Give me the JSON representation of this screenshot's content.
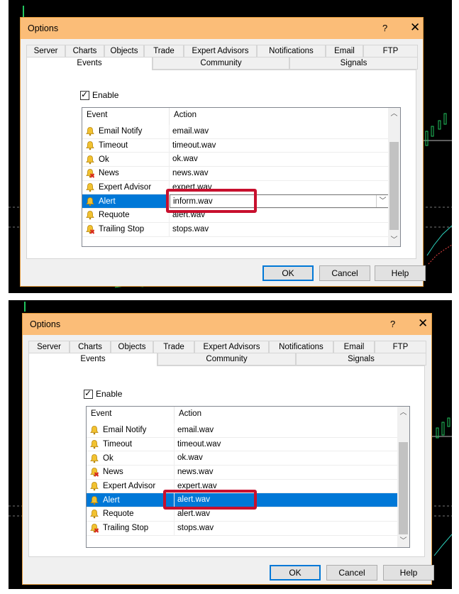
{
  "dialog": {
    "title": "Options",
    "help_glyph": "?",
    "close_glyph": "✕",
    "tabs_row1": [
      "Server",
      "Charts",
      "Objects",
      "Trade",
      "Expert Advisors",
      "Notifications",
      "Email",
      "FTP"
    ],
    "tabs_row2": [
      "Events",
      "Community",
      "Signals"
    ],
    "active_tab": "Events",
    "enable_label": "Enable",
    "enable_checked": true,
    "columns": {
      "event": "Event",
      "action": "Action"
    },
    "buttons": {
      "ok": "OK",
      "cancel": "Cancel",
      "help": "Help"
    }
  },
  "screenshot_top": {
    "rows": [
      {
        "event": "Email Notify",
        "action": "email.wav",
        "icon": "bell-icon"
      },
      {
        "event": "Timeout",
        "action": "timeout.wav",
        "icon": "bell-icon"
      },
      {
        "event": "Ok",
        "action": "ok.wav",
        "icon": "bell-icon"
      },
      {
        "event": "News",
        "action": "news.wav",
        "icon": "bell-disabled-icon"
      },
      {
        "event": "Expert Advisor",
        "action": "expert.wav",
        "icon": "bell-icon"
      },
      {
        "event": "Alert",
        "action": "inform.wav",
        "icon": "bell-icon",
        "state": "editing"
      },
      {
        "event": "Requote",
        "action": "alert.wav",
        "icon": "bell-icon"
      },
      {
        "event": "Trailing Stop",
        "action": "stops.wav",
        "icon": "bell-disabled-icon"
      }
    ]
  },
  "screenshot_bottom": {
    "rows": [
      {
        "event": "Email Notify",
        "action": "email.wav",
        "icon": "bell-icon"
      },
      {
        "event": "Timeout",
        "action": "timeout.wav",
        "icon": "bell-icon"
      },
      {
        "event": "Ok",
        "action": "ok.wav",
        "icon": "bell-icon"
      },
      {
        "event": "News",
        "action": "news.wav",
        "icon": "bell-disabled-icon"
      },
      {
        "event": "Expert Advisor",
        "action": "expert.wav",
        "icon": "bell-icon"
      },
      {
        "event": "Alert",
        "action": "alert.wav",
        "icon": "bell-icon",
        "state": "selected"
      },
      {
        "event": "Requote",
        "action": "alert.wav",
        "icon": "bell-icon"
      },
      {
        "event": "Trailing Stop",
        "action": "stops.wav",
        "icon": "bell-disabled-icon"
      }
    ]
  },
  "colors": {
    "titlebar": "#fbbd78",
    "selection": "#0078d7",
    "highlight_box": "#c8102e",
    "chart_background": "#000000"
  }
}
